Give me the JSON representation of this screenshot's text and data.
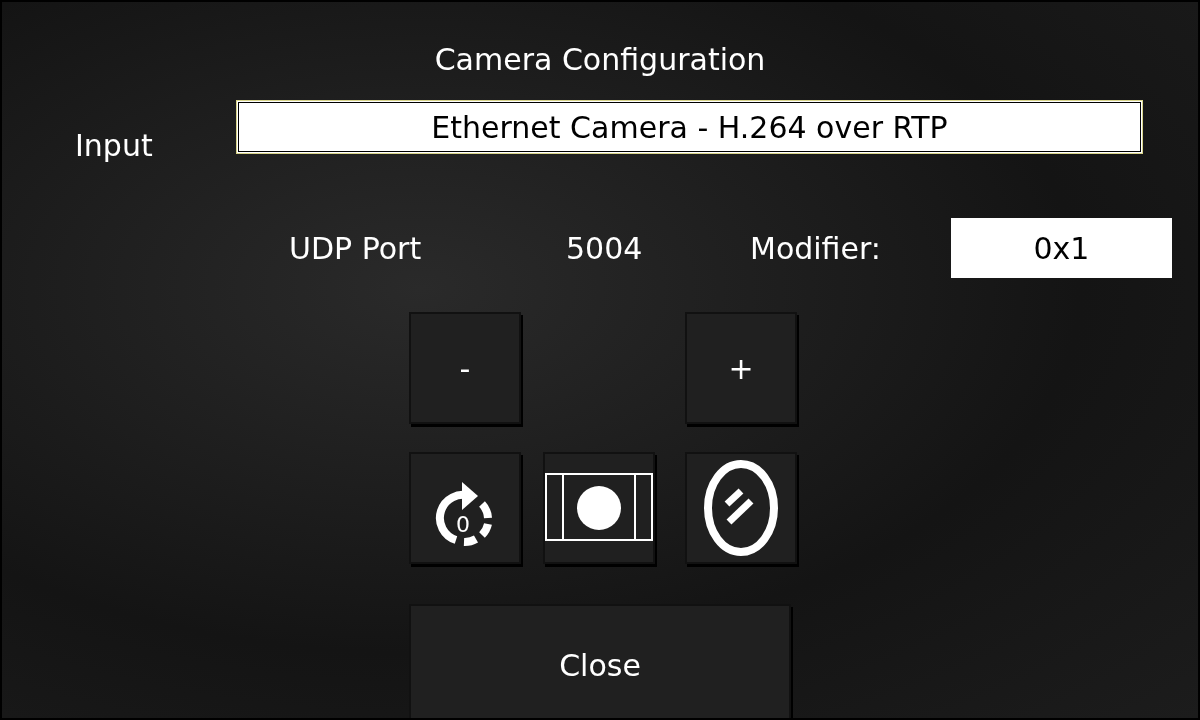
{
  "title": "Camera Configuration",
  "input": {
    "label": "Input",
    "value": "Ethernet Camera - H.264 over RTP"
  },
  "port": {
    "label": "UDP Port",
    "value": "5004"
  },
  "modifier": {
    "label": "Modifier:",
    "value": "0x1"
  },
  "buttons": [
    {
      "kind": "text",
      "label": "-"
    },
    {
      "kind": "text",
      "label": "+"
    },
    {
      "kind": "rotate",
      "label": "0"
    },
    {
      "kind": "aspect"
    },
    {
      "kind": "mirror"
    }
  ],
  "close": "Close"
}
